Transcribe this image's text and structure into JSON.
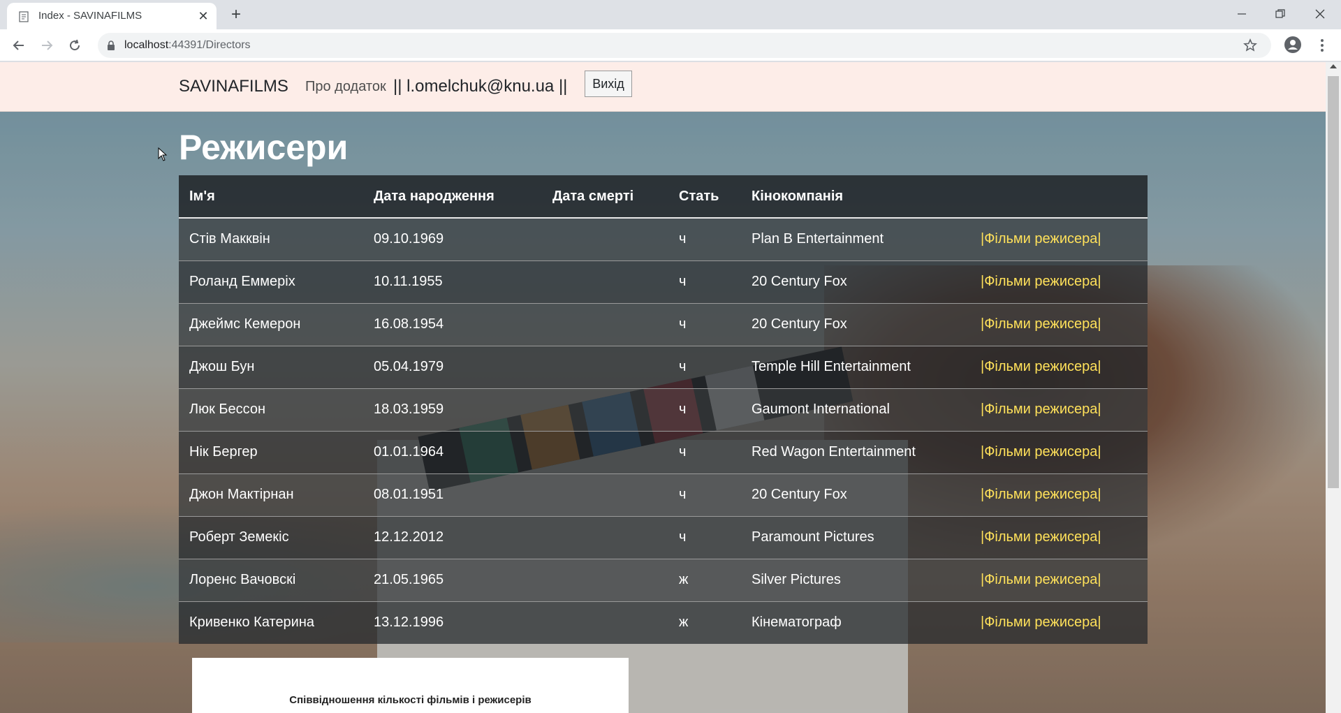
{
  "browser": {
    "tab_title": "Index - SAVINAFILMS",
    "url_host": "localhost",
    "url_rest": ":44391/Directors"
  },
  "nav": {
    "brand": "SAVINAFILMS",
    "about": "Про додаток",
    "user": "|| l.omelchuk@knu.ua ||",
    "logout": "Вихід"
  },
  "page": {
    "title": "Режисери"
  },
  "table": {
    "headers": [
      "Ім'я",
      "Дата народження",
      "Дата смерті",
      "Стать",
      "Кінокомпанія",
      ""
    ],
    "link_label": "|Фільми режисера|",
    "rows": [
      {
        "name": "Стів Макквін",
        "birth": "09.10.1969",
        "death": "",
        "sex": "ч",
        "studio": "Plan B Entertainment"
      },
      {
        "name": "Роланд Еммеріх",
        "birth": "10.11.1955",
        "death": "",
        "sex": "ч",
        "studio": "20 Century Fox"
      },
      {
        "name": "Джеймс Кемерон",
        "birth": "16.08.1954",
        "death": "",
        "sex": "ч",
        "studio": "20 Century Fox"
      },
      {
        "name": "Джош Бун",
        "birth": "05.04.1979",
        "death": "",
        "sex": "ч",
        "studio": "Temple Hill Entertainment"
      },
      {
        "name": "Люк Бессон",
        "birth": "18.03.1959",
        "death": "",
        "sex": "ч",
        "studio": "Gaumont International"
      },
      {
        "name": "Нік Бергер",
        "birth": "01.01.1964",
        "death": "",
        "sex": "ч",
        "studio": "Red Wagon Entertainment"
      },
      {
        "name": "Джон Мактірнан",
        "birth": "08.01.1951",
        "death": "",
        "sex": "ч",
        "studio": "20 Century Fox"
      },
      {
        "name": "Роберт Земекіс",
        "birth": "12.12.2012",
        "death": "",
        "sex": "ч",
        "studio": "Paramount Pictures"
      },
      {
        "name": "Лоренс Вачовскі",
        "birth": "21.05.1965",
        "death": "",
        "sex": "ж",
        "studio": "Silver Pictures"
      },
      {
        "name": "Кривенко Катерина",
        "birth": "13.12.1996",
        "death": "",
        "sex": "ж",
        "studio": "Кінематограф"
      }
    ]
  },
  "chart": {
    "title": "Співвідношення кількості фільмів і режисерів"
  },
  "colors": {
    "navbar_bg": "#fdede8",
    "link": "#ffe15a",
    "table_bg": "#212529"
  }
}
